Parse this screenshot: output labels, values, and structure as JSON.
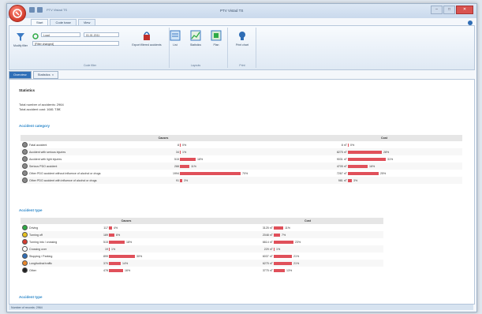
{
  "window": {
    "title": "PTV Vistad TS",
    "qat_title": "PTV Vistad TS"
  },
  "ribbon": {
    "tabs": [
      "Start",
      "Code base",
      "View"
    ],
    "active_tab": 0,
    "filter": {
      "label": "Modify filter",
      "preset_label": "Load",
      "date_value": "01.01.2011",
      "combo_value": "[Filter changed]"
    },
    "groups": [
      "Code filter",
      "Layouts",
      "Print"
    ],
    "buttons": {
      "export": "Export filtered accidents",
      "list": "List",
      "statistics": "Statistics",
      "plan": "Plan",
      "print": "Print chart"
    }
  },
  "doc_tabs": [
    "Overview",
    "Statistics"
  ],
  "report": {
    "heading": "Statistics",
    "total_count": "Total number of accidents: 2964",
    "total_cost": "Total accident cost: 1681 T.$€"
  },
  "accident_category": {
    "title": "Accident category",
    "headers": [
      "Causes",
      "Cost"
    ],
    "rows": [
      {
        "label": "Fatal accident",
        "count": "8",
        "count_pct": "0%",
        "count_share": 0.0,
        "cost": "8 nT",
        "cost_pct": "0%",
        "cost_share": 0.0,
        "color": "#888888"
      },
      {
        "label": "Accident with serious injuries",
        "count": "34",
        "count_pct": "1%",
        "count_share": 0.01,
        "cost": "8275 nT",
        "cost_pct": "28%",
        "cost_share": 0.28,
        "color": "#888888"
      },
      {
        "label": "Accident with light injuries",
        "count": "515",
        "count_pct": "18%",
        "count_share": 0.18,
        "cost": "9031 nT",
        "cost_pct": "31%",
        "cost_share": 0.31,
        "color": "#888888"
      },
      {
        "label": "Serious PDO accident",
        "count": "288",
        "count_pct": "11%",
        "count_share": 0.11,
        "cost": "4705 nT",
        "cost_pct": "16%",
        "cost_share": 0.16,
        "color": "#888888"
      },
      {
        "label": "Other PDO accident without influence of alcohol or drugs",
        "count": "1994",
        "count_pct": "70%",
        "count_share": 0.7,
        "cost": "7267 nT",
        "cost_pct": "25%",
        "cost_share": 0.25,
        "color": "#888888"
      },
      {
        "label": "Other PDO accident with influence of alcohol or drugs",
        "count": "91",
        "count_pct": "3%",
        "count_share": 0.03,
        "cost": "981 nT",
        "cost_pct": "3%",
        "cost_share": 0.03,
        "color": "#888888"
      }
    ]
  },
  "accident_type": {
    "title": "Accident type",
    "headers": [
      "Causes",
      "Cost"
    ],
    "rows": [
      {
        "label": "Driving",
        "count": "117",
        "count_pct": "4%",
        "count_share": 0.04,
        "cost": "3125 nT",
        "cost_pct": "11%",
        "cost_share": 0.11,
        "color": "#2eaa45"
      },
      {
        "label": "Turning off",
        "count": "189",
        "count_pct": "6%",
        "count_share": 0.06,
        "cost": "2048 nT",
        "cost_pct": "7%",
        "cost_share": 0.07,
        "color": "#e8c21e"
      },
      {
        "label": "Turning into / crossing",
        "count": "515",
        "count_pct": "18%",
        "count_share": 0.18,
        "cost": "6614 nT",
        "cost_pct": "23%",
        "cost_share": 0.23,
        "color": "#d43a2f"
      },
      {
        "label": "Crossing over",
        "count": "19",
        "count_pct": "1%",
        "count_share": 0.01,
        "cost": "229 nT",
        "cost_pct": "1%",
        "cost_share": 0.01,
        "color": "#ffffff"
      },
      {
        "label": "Stopping / Parking",
        "count": "899",
        "count_pct": "30%",
        "count_share": 0.3,
        "cost": "6037 nT",
        "cost_pct": "21%",
        "cost_share": 0.21,
        "color": "#2f6db5"
      },
      {
        "label": "Longitudinal traffic",
        "count": "370",
        "count_pct": "14%",
        "count_share": 0.14,
        "cost": "6275 nT",
        "cost_pct": "21%",
        "cost_share": 0.21,
        "color": "#e8862a"
      },
      {
        "label": "Other",
        "count": "478",
        "count_pct": "16%",
        "count_share": 0.16,
        "cost": "3775 nT",
        "cost_pct": "13%",
        "cost_share": 0.13,
        "color": "#222222"
      }
    ]
  },
  "next_section_title": "Accident type",
  "statusbar": "Number of records: 2964",
  "colors": {
    "bar": "#e0505a",
    "accent": "#2f6fb7",
    "section_title": "#2b87c9"
  }
}
